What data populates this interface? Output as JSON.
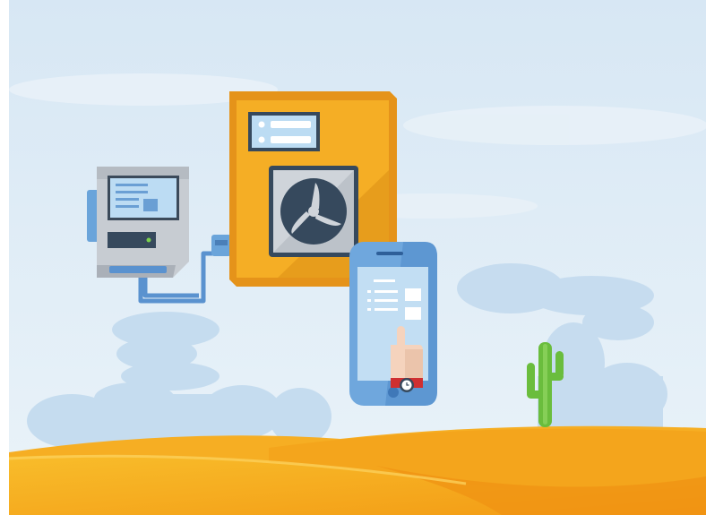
{
  "illustration": {
    "icons": {
      "controller": "wall-controller-icon",
      "cabinet": "ventilation-cabinet-icon",
      "fan": "fan-icon",
      "phone": "smartphone-icon",
      "hand": "tapping-hand-icon",
      "watch": "wristwatch-icon",
      "cactus": "cactus-icon",
      "dunes": "sand-dunes",
      "clouds": "rock-clouds"
    },
    "colors": {
      "sky_top": "#dceaf5",
      "sky_bottom": "#e9f2f8",
      "clouds": "#c6dcef",
      "cabinet_orange": "#f2a21c",
      "cabinet_border": "#e59419",
      "cabinet_shade": "#e08c17",
      "dark_panel": "#36495d",
      "screen_blue": "#b9d9f1",
      "controller_gray": "#c9cdd2",
      "phone_blue": "#6fa6dc",
      "pipe_blue": "#5b93cf",
      "cactus_green": "#6bbf3f",
      "sand_light": "#f7b525",
      "sand_dark": "#f19a14",
      "watch_strap": "#cf2f31",
      "skin": "#f5d3bd"
    }
  }
}
